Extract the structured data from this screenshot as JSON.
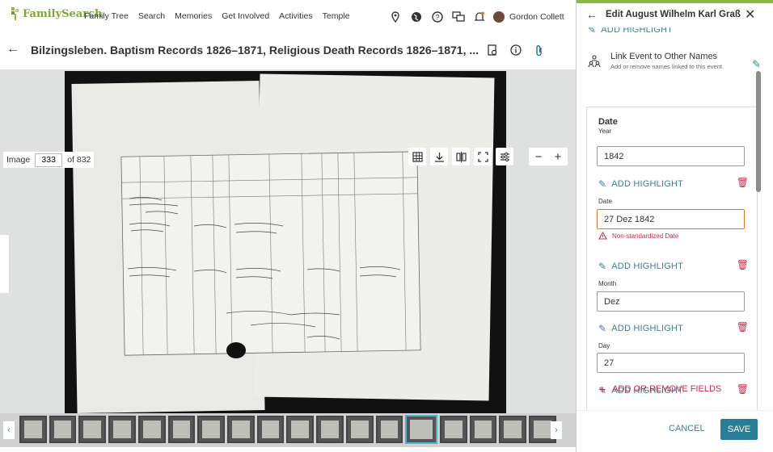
{
  "nav": {
    "brand": "FamilySearch",
    "items": [
      "Family Tree",
      "Search",
      "Memories",
      "Get Involved",
      "Activities",
      "Temple"
    ],
    "user": "Gordon Collett",
    "icons": [
      "location-pin-icon",
      "globe-icon",
      "help-icon",
      "messages-icon",
      "notifications-icon"
    ]
  },
  "record": {
    "title": "Bilzingsleben. Baptism Records 1826–1871, Religious Death Records 1826–1871, ...",
    "icons": [
      "document-search-icon",
      "info-icon",
      "attachment-icon"
    ]
  },
  "viewer": {
    "image_label": "Image",
    "image_number": "333",
    "image_total": "of 832",
    "tools": [
      "grid-icon",
      "download-icon",
      "compare-icon",
      "fullscreen-icon",
      "adjust-icon"
    ],
    "zoom_out": "−",
    "zoom_in": "+"
  },
  "filmstrip": {
    "count": 18,
    "selected_index": 13,
    "prev": "‹",
    "next": "›"
  },
  "panel": {
    "title": "Edit August Wilhelm Karl Graß",
    "top_highlight": "ADD HIGHLIGHT",
    "link_title": "Link Event to Other Names",
    "link_subtitle": "Add or remove names linked to this event.",
    "section": "Date",
    "year_label": "Year",
    "year_value": "1842",
    "add_highlight": "ADD HIGHLIGHT",
    "date_label": "Date",
    "date_value": "27 Dez 1842",
    "warning": "Non-standardized Date",
    "month_label": "Month",
    "month_value": "Dez",
    "day_label": "Day",
    "day_value": "27",
    "add_fields": "ADD OR REMOVE FIELDS",
    "cancel": "CANCEL",
    "save": "SAVE"
  },
  "colors": {
    "accent": "#3d8093",
    "save": "#2a7d96",
    "delete": "#c4304c",
    "brand": "#8cba3e",
    "error": "#d77a2f"
  }
}
